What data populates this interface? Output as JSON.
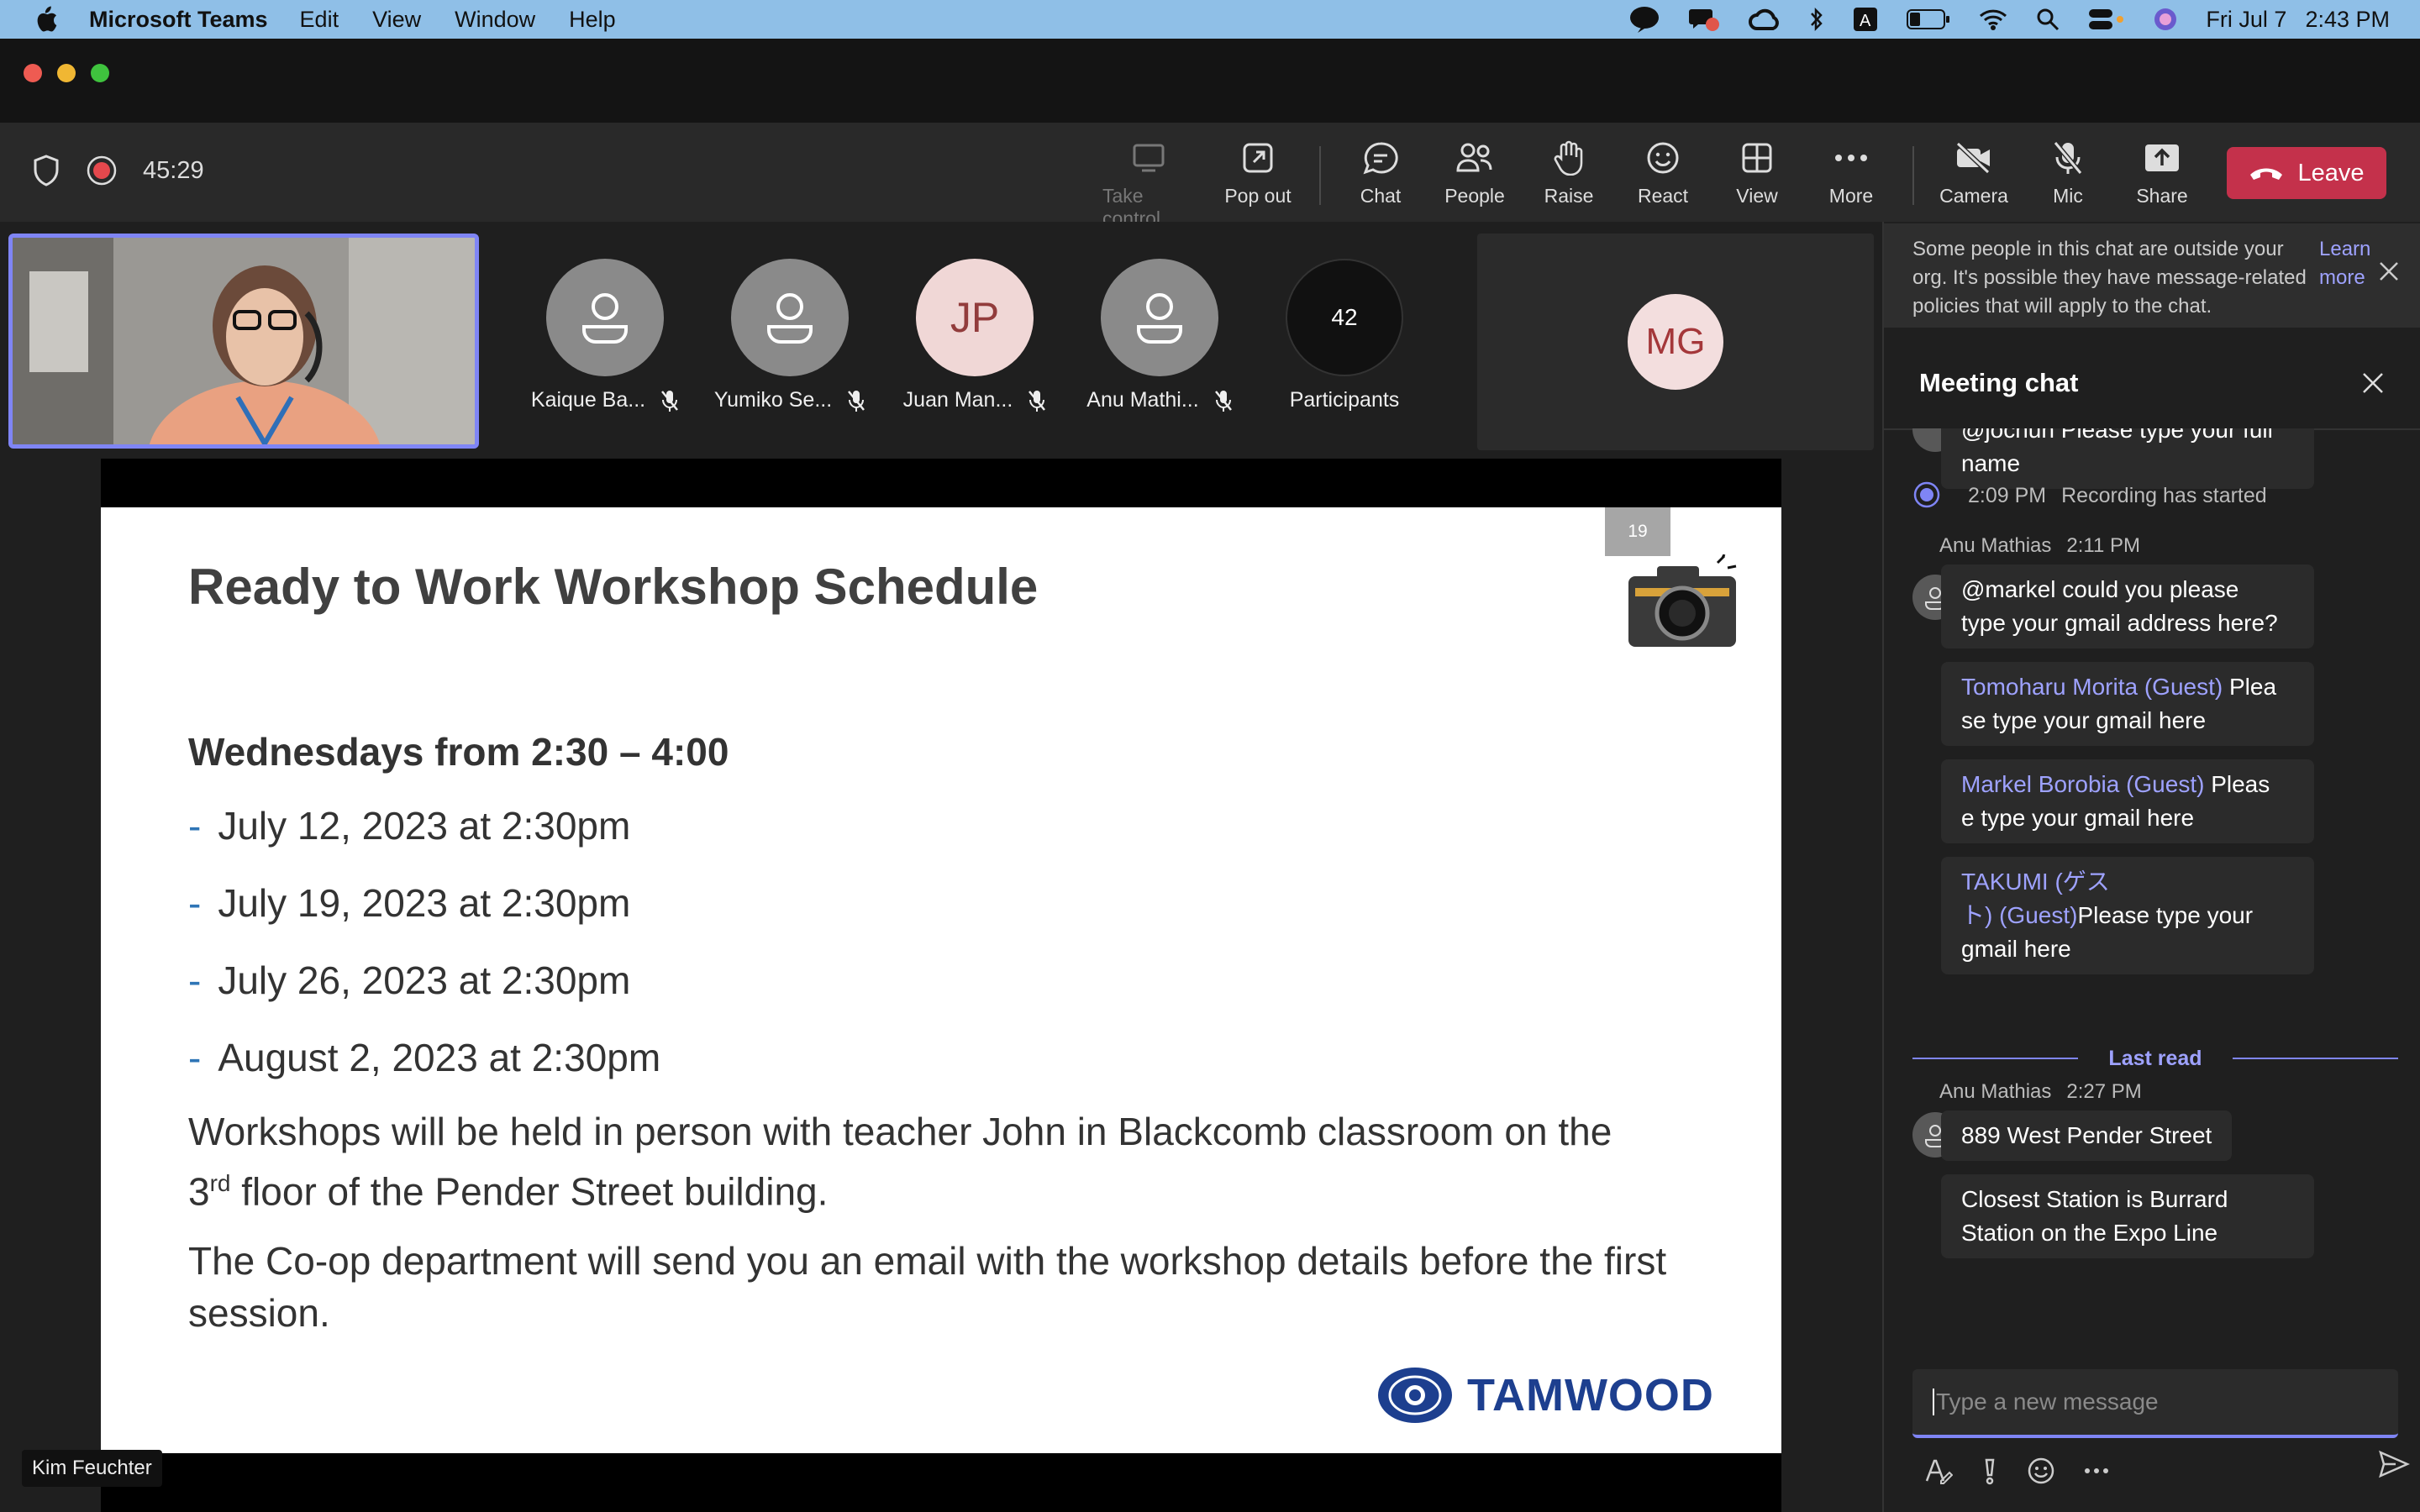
{
  "menubar": {
    "app_name": "Microsoft Teams",
    "items": [
      "Edit",
      "View",
      "Window",
      "Help"
    ],
    "date": "Fri Jul 7",
    "time": "2:43 PM"
  },
  "meeting": {
    "timer": "45:29",
    "toolbar": {
      "take_control": "Take control",
      "pop_out": "Pop out",
      "chat": "Chat",
      "people": "People",
      "raise": "Raise",
      "react": "React",
      "view": "View",
      "more": "More",
      "camera": "Camera",
      "mic": "Mic",
      "share": "Share",
      "leave": "Leave"
    }
  },
  "gallery": {
    "participants": [
      {
        "name": "Kaique Ba...",
        "initials": ""
      },
      {
        "name": "Yumiko Se...",
        "initials": ""
      },
      {
        "name": "Juan Man...",
        "initials": "JP"
      },
      {
        "name": "Anu Mathi...",
        "initials": ""
      }
    ],
    "participant_count": "42",
    "participant_label": "Participants",
    "mg_initials": "MG"
  },
  "slide": {
    "number": "19",
    "title": "Ready to Work Workshop Schedule",
    "subtitle": "Wednesdays from 2:30 – 4:00",
    "dates": [
      "July 12, 2023 at 2:30pm",
      "July 19, 2023 at 2:30pm",
      "July 26, 2023 at 2:30pm",
      "August 2, 2023 at 2:30pm"
    ],
    "para1_a": "Workshops will be held in person with teacher John in Blackcomb classroom on the",
    "para1_num": "3",
    "para1_sup": "rd",
    "para1_b": " floor of the Pender Street building.",
    "para2": "The Co-op department will send you an email with the workshop details before the first session.",
    "logo_text": "TAMWOOD",
    "presenter": "Kim Feuchter"
  },
  "chat": {
    "notice": "Some people in this chat are outside your org. It's possible they have message-related policies that will apply to the chat.",
    "learn_more": "Learn more",
    "title": "Meeting chat",
    "partial_msg_line1": "@jochun Please type your full",
    "partial_msg_line2": "name",
    "system_time": "2:09 PM",
    "system_text": "Recording has started",
    "msg1_author": "Anu Mathias",
    "msg1_time": "2:11 PM",
    "msg1_line1": "@markel could you please",
    "msg1_line2": "type your gmail address here?",
    "msg2_guest": "Tomoharu Morita (Guest)",
    "msg2_tail1": " Plea",
    "msg2_line2": "se type your gmail here",
    "msg3_guest": "Markel Borobia (Guest)",
    "msg3_tail1": " Pleas",
    "msg3_line2": "e type your gmail here",
    "msg4_guest1": "TAKUMI (ゲス",
    "msg4_guest2": "ト) (Guest)",
    "msg4_tail2": "Please type your",
    "msg4_line3": "gmail here",
    "last_read": "Last read",
    "msg5_author": "Anu Mathias",
    "msg5_time": "2:27 PM",
    "msg5_text": "889 West Pender Street",
    "msg6_line1": "Closest Station is Burrard",
    "msg6_line2": "Station on the Expo Line",
    "compose_placeholder": "Type a new message"
  }
}
